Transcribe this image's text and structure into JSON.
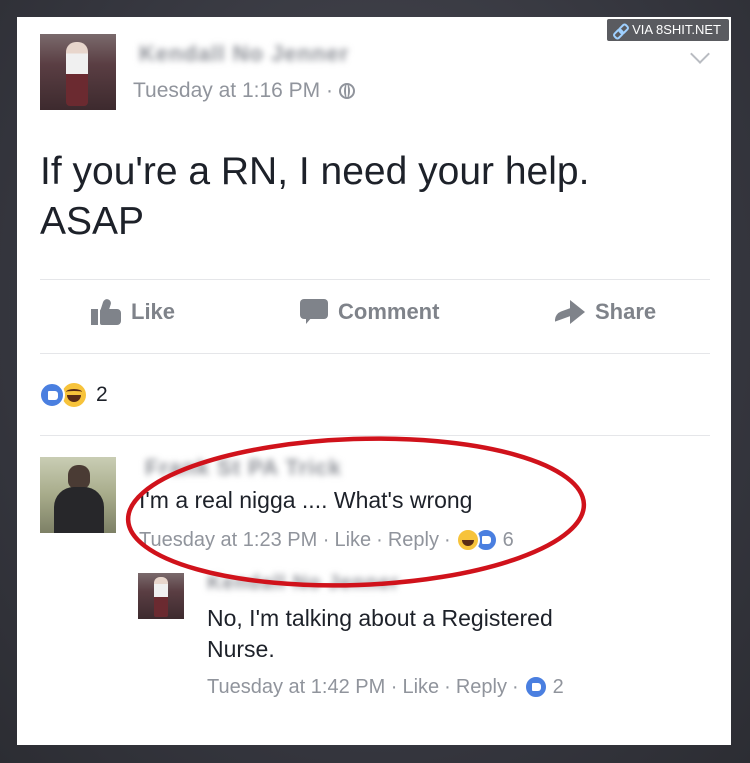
{
  "watermark": {
    "text": "VIA 8SHIT.NET"
  },
  "post": {
    "author": "Kendall No Jenner",
    "timestamp": "Tuesday at 1:16 PM ·",
    "text_line1": "If you're a RN, I need your help.",
    "text_line2": "ASAP",
    "actions": {
      "like": "Like",
      "comment": "Comment",
      "share": "Share"
    },
    "reaction_count": "2"
  },
  "comments": [
    {
      "author": "Frank St PA Trick",
      "text": "I'm a real nigga .... What's wrong",
      "time": "Tuesday at 1:23 PM ·",
      "like": "Like",
      "reply": "Reply",
      "reaction_count": "6"
    },
    {
      "author": "Kendall No Jenner",
      "text_line1": "No, I'm talking about a Registered",
      "text_line2": "Nurse.",
      "time": "Tuesday at 1:42 PM ·",
      "like": "Like",
      "reply": "Reply",
      "reaction_count": "2"
    }
  ],
  "colors": {
    "like_blue": "#4a7fe0",
    "haha_yellow": "#f7c33b",
    "highlight_red": "#d0121b",
    "meta_gray": "#90949c"
  }
}
